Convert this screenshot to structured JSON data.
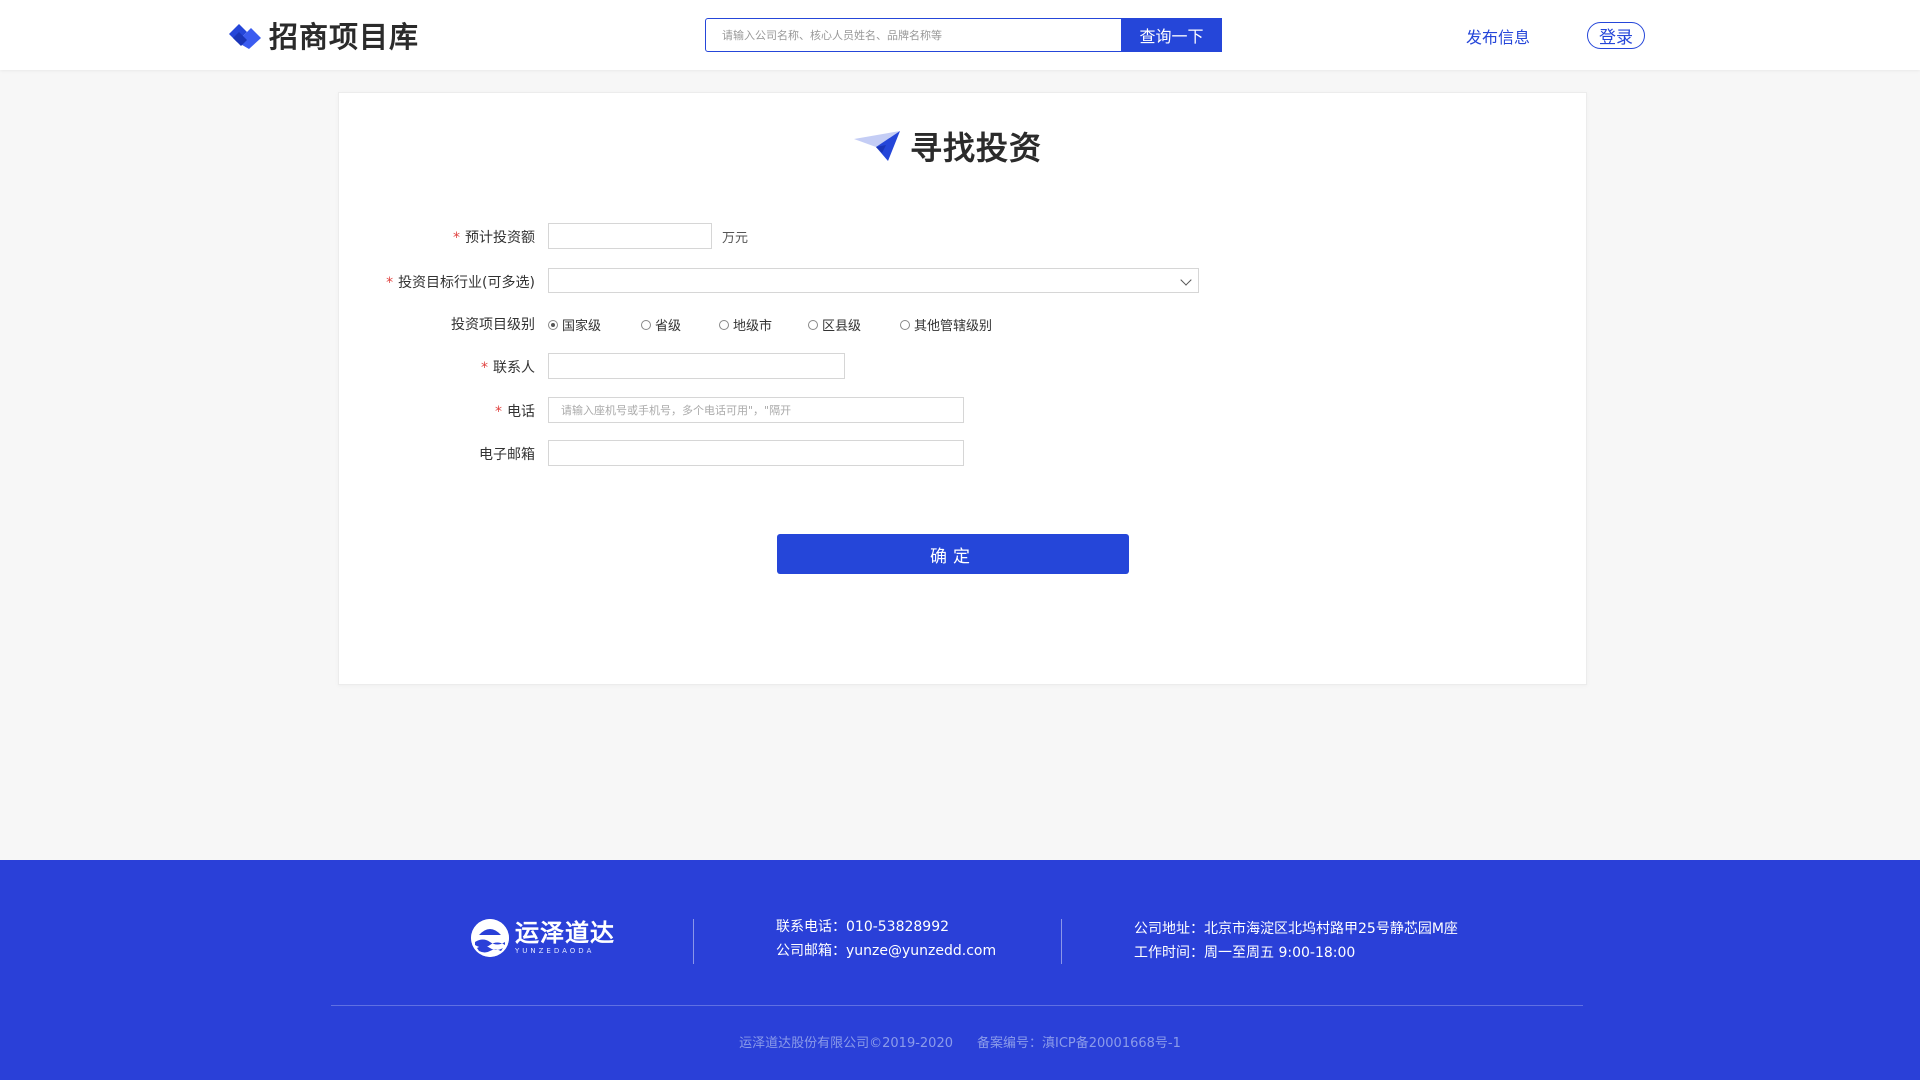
{
  "header": {
    "logo_text": "招商项目库",
    "search_placeholder": "请输入公司名称、核心人员姓名、品牌名称等",
    "search_button": "查询一下",
    "publish_link": "发布信息",
    "login_button": "登录"
  },
  "form": {
    "title": "寻找投资",
    "fields": {
      "amount": {
        "label": "预计投资额",
        "required": true,
        "value": "",
        "unit": "万元"
      },
      "industry": {
        "label": "投资目标行业(可多选)",
        "required": true,
        "value": ""
      },
      "level": {
        "label": "投资项目级别",
        "required": false,
        "options": [
          "国家级",
          "省级",
          "地级市",
          "区县级",
          "其他管辖级别"
        ],
        "selected": "国家级"
      },
      "contact": {
        "label": "联系人",
        "required": true,
        "value": ""
      },
      "phone": {
        "label": "电话",
        "required": true,
        "value": "",
        "placeholder": "请输入座机号或手机号，多个电话可用\"，\"隔开"
      },
      "email": {
        "label": "电子邮箱",
        "required": false,
        "value": ""
      }
    },
    "required_mark": "*",
    "confirm_button": "确定"
  },
  "footer": {
    "logo_cn": "运泽道达",
    "logo_en": "YUNZEDAODA",
    "phone_label": "联系电话：",
    "phone": "010-53828992",
    "email_label": "公司邮箱：",
    "email": "yunze@yunzedd.com",
    "address_label": "公司地址：",
    "address": "北京市海淀区北坞村路甲25号静芯园M座",
    "hours_label": "工作时间：",
    "hours": "周一至周五  9:00-18:00",
    "copyright": "运泽道达股份有限公司©2019-2020",
    "icp": "备案编号：滇ICP备20001668号-1"
  },
  "colors": {
    "primary": "#2546d9",
    "footer_bg": "#2a40d8",
    "required": "#e0423f"
  },
  "icons": {
    "logo": "handshake-logo-icon",
    "title": "paper-plane-icon",
    "select": "chevron-down-icon",
    "footer_logo": "boat-wave-logo-icon"
  }
}
